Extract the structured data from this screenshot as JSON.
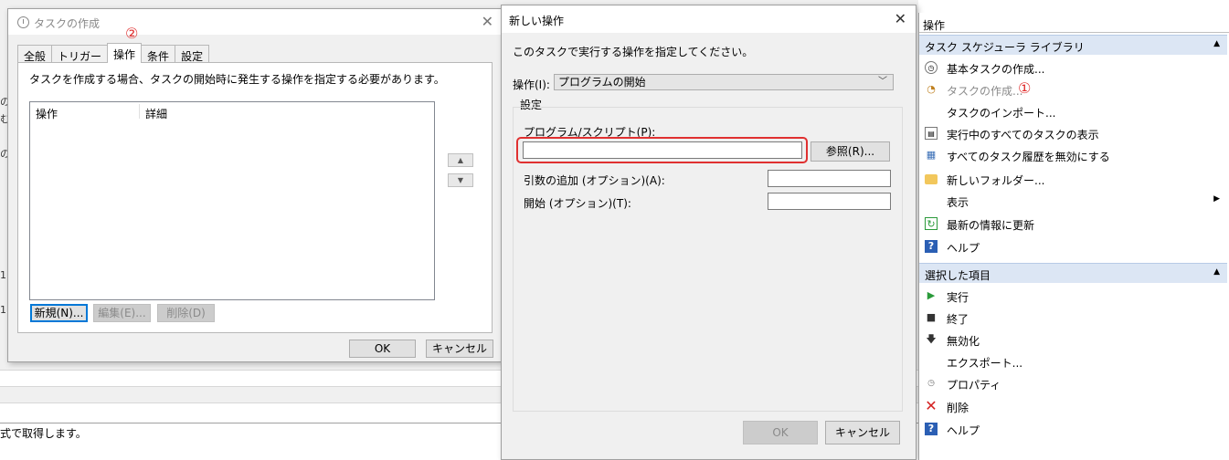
{
  "background": {
    "status_text": "式で取得します。",
    "left_fragments": [
      "の",
      "む",
      "の",
      "1.",
      "1."
    ]
  },
  "task_dialog": {
    "title": "タスクの作成",
    "tabs": [
      "全般",
      "トリガー",
      "操作",
      "条件",
      "設定"
    ],
    "active_tab": "操作",
    "description": "タスクを作成する場合、タスクの開始時に発生する操作を指定する必要があります。",
    "columns": [
      "操作",
      "詳細"
    ],
    "buttons": {
      "new": "新規(N)...",
      "edit": "編集(E)...",
      "delete": "削除(D)",
      "ok": "OK",
      "cancel": "キャンセル"
    },
    "badge": "②"
  },
  "action_dialog": {
    "title": "新しい操作",
    "instruction": "このタスクで実行する操作を指定してください。",
    "action_label": "操作(I):",
    "action_value": "プログラムの開始",
    "settings_label": "設定",
    "program_label": "プログラム/スクリプト(P):",
    "program_value": "",
    "browse_button": "参照(R)...",
    "args_label": "引数の追加 (オプション)(A):",
    "args_value": "",
    "start_label": "開始 (オプション)(T):",
    "start_value": "",
    "ok": "OK",
    "cancel": "キャンセル"
  },
  "actions_pane": {
    "header": "操作",
    "section1": {
      "title": "タスク スケジューラ ライブラリ",
      "items": [
        {
          "label": "基本タスクの作成...",
          "icon": "basic-task-icon"
        },
        {
          "label": "タスクの作成...",
          "icon": "create-task-icon",
          "badge": "①"
        },
        {
          "label": "タスクのインポート...",
          "icon": ""
        },
        {
          "label": "実行中のすべてのタスクの表示",
          "icon": "running-tasks-icon"
        },
        {
          "label": "すべてのタスク履歴を無効にする",
          "icon": "history-icon"
        },
        {
          "label": "新しいフォルダー...",
          "icon": "folder-icon"
        },
        {
          "label": "表示",
          "icon": ""
        },
        {
          "label": "最新の情報に更新",
          "icon": "refresh-icon"
        },
        {
          "label": "ヘルプ",
          "icon": "help-icon"
        }
      ]
    },
    "section2": {
      "title": "選択した項目",
      "items": [
        {
          "label": "実行",
          "icon": "run-icon"
        },
        {
          "label": "終了",
          "icon": "stop-icon"
        },
        {
          "label": "無効化",
          "icon": "disable-icon"
        },
        {
          "label": "エクスポート...",
          "icon": ""
        },
        {
          "label": "プロパティ",
          "icon": "properties-icon"
        },
        {
          "label": "削除",
          "icon": "delete-icon"
        },
        {
          "label": "ヘルプ",
          "icon": "help-icon"
        }
      ]
    }
  }
}
